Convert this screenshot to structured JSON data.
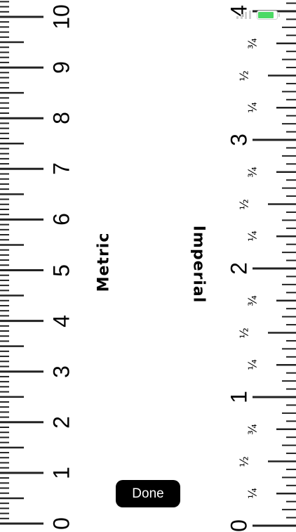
{
  "metric": {
    "label": "Metric",
    "numbers": [
      "0",
      "1",
      "2",
      "3",
      "4",
      "5",
      "6",
      "7",
      "8",
      "9",
      "10"
    ]
  },
  "imperial": {
    "label": "Imperial",
    "numbers": [
      "0",
      "1",
      "2",
      "3",
      "4"
    ],
    "fractions": [
      "¼",
      "½",
      "¾"
    ]
  },
  "done_label": "Done",
  "status_bar": {
    "battery_level": 0.85,
    "battery_color": "#4cd964"
  }
}
